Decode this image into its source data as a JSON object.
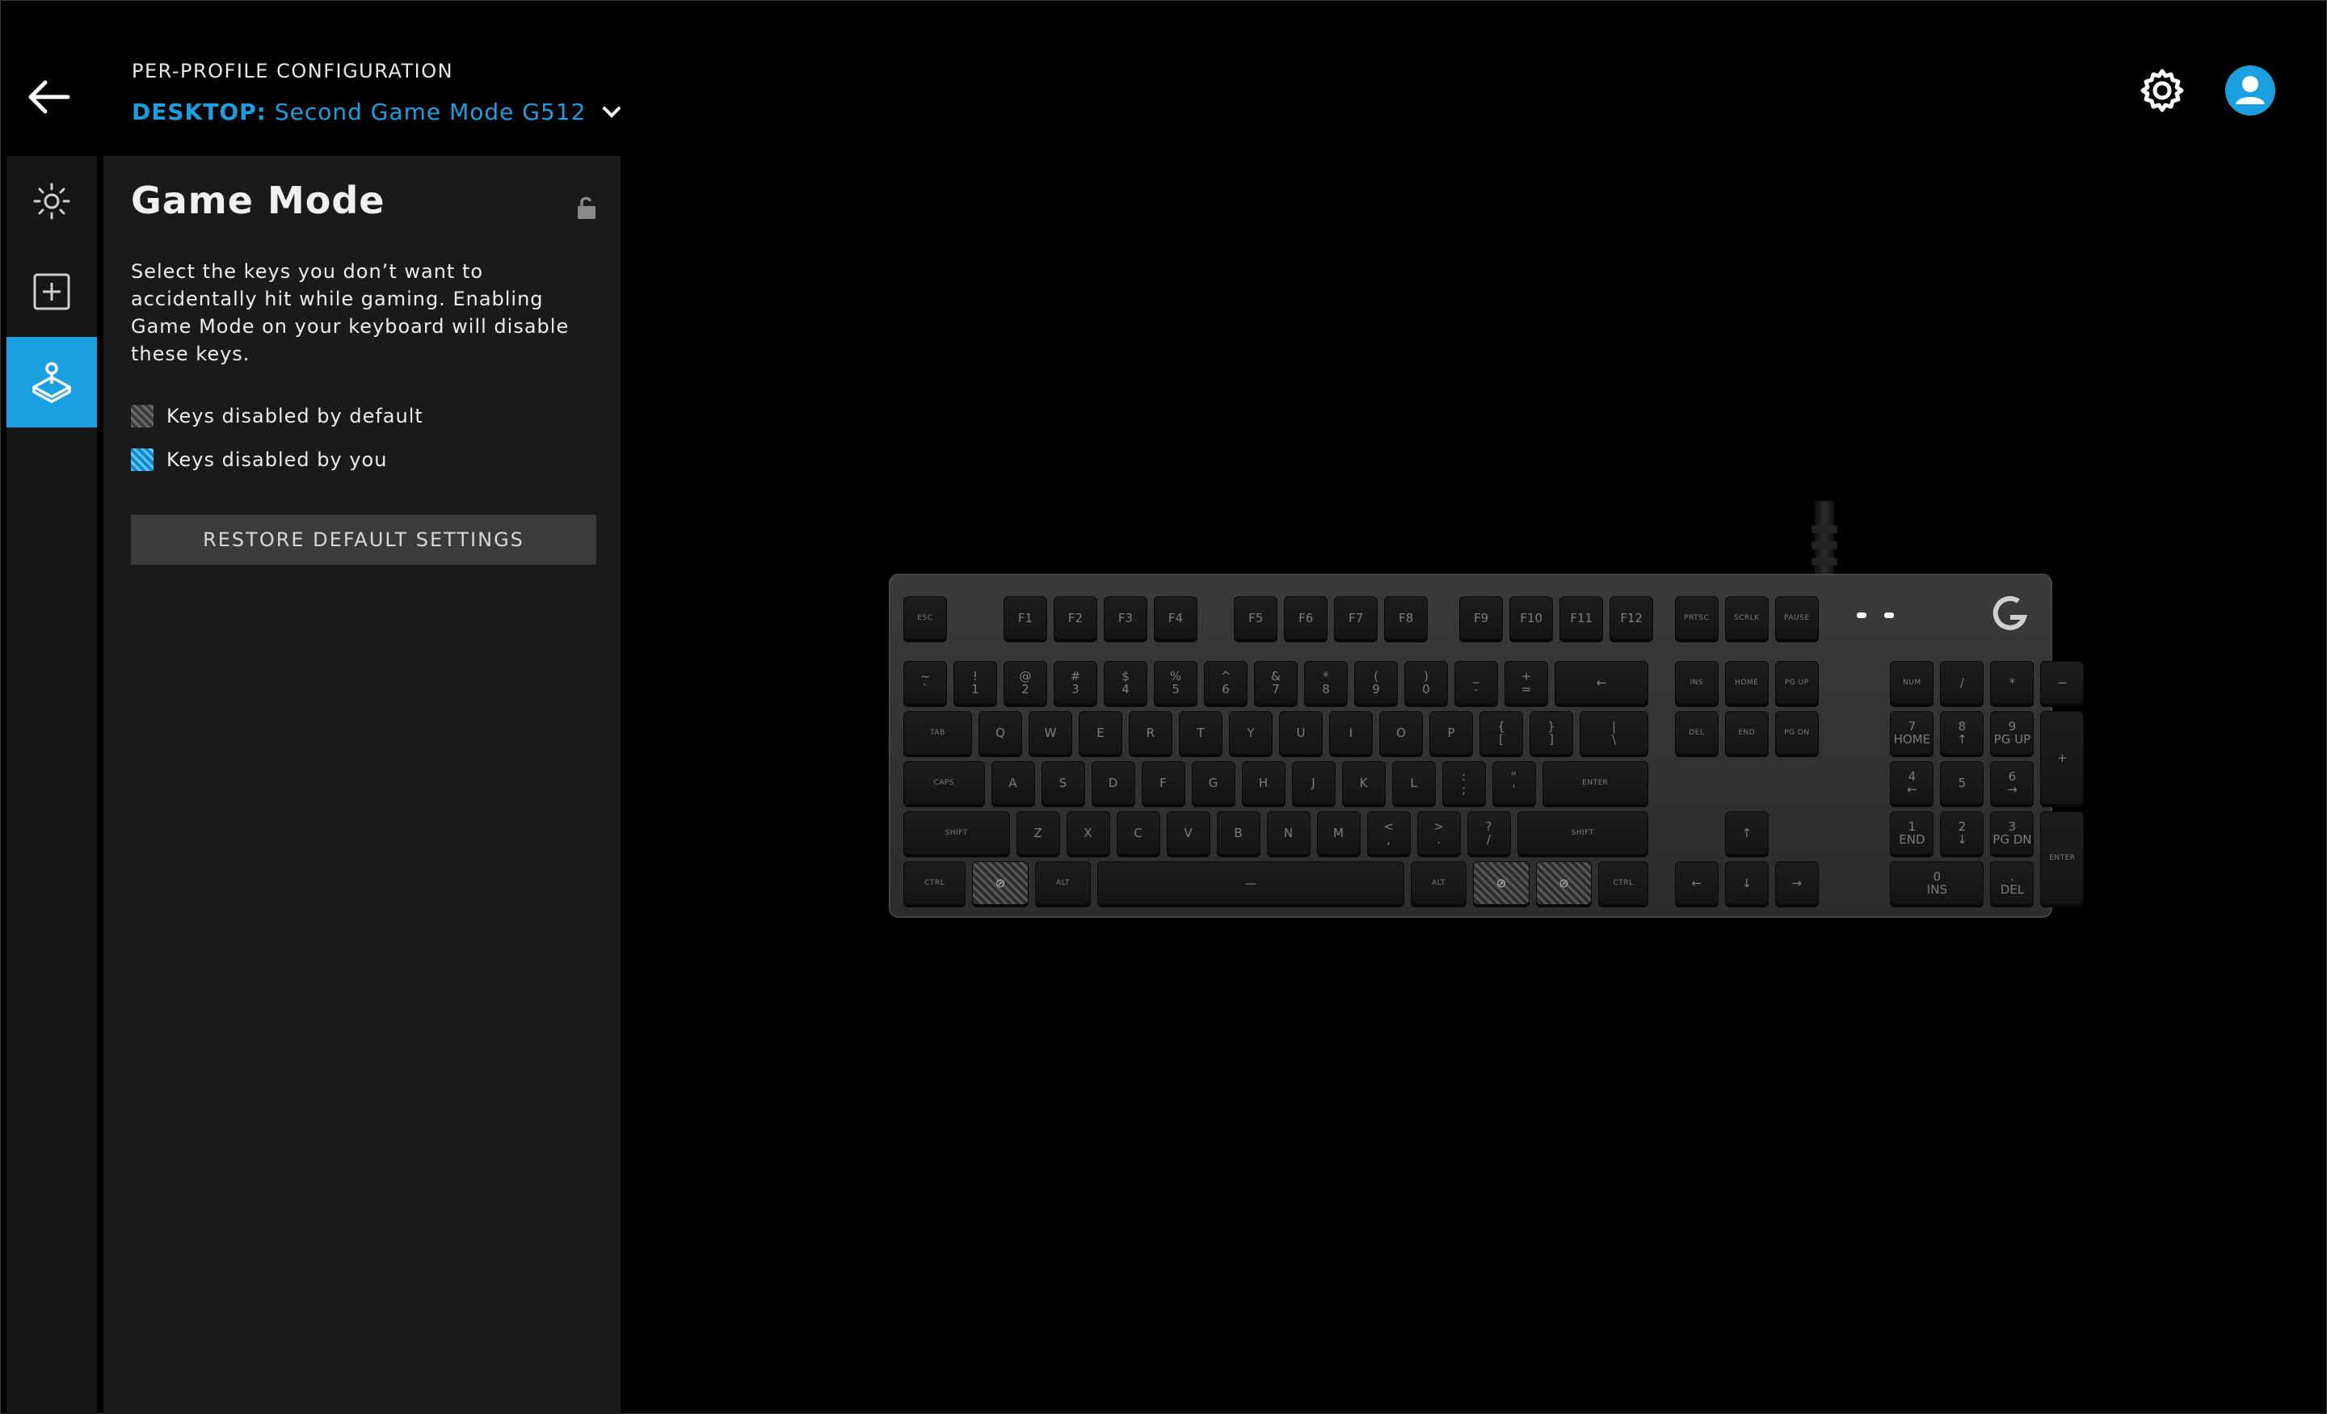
{
  "header": {
    "section_label": "PER-PROFILE CONFIGURATION",
    "profile_prefix": "DESKTOP:",
    "profile_name": "Second Game Mode G512",
    "icons": {
      "back": "arrow-left-icon",
      "dropdown": "chevron-down-icon",
      "settings": "gear-icon",
      "account": "user-avatar-icon"
    }
  },
  "rail": {
    "items": [
      {
        "id": "lighting",
        "icon": "sun-icon"
      },
      {
        "id": "assignments",
        "icon": "plus-square-icon"
      },
      {
        "id": "game-mode",
        "icon": "joystick-icon",
        "active": true
      }
    ]
  },
  "panel": {
    "title": "Game Mode",
    "lock_icon": "unlock-icon",
    "description": "Select the keys you don’t want to accidentally hit while gaming. Enabling Game Mode on your keyboard will disable these keys.",
    "legend": [
      {
        "label": "Keys disabled by default",
        "swatch": "default"
      },
      {
        "label": "Keys disabled by you",
        "swatch": "user"
      }
    ],
    "restore_label": "RESTORE DEFAULT SETTINGS"
  },
  "colors": {
    "accent": "#1aa0e0",
    "background": "#000000",
    "panel": "#1a1a1a",
    "rail": "#161616"
  },
  "keyboard": {
    "logo": "logitech-g-logo-icon",
    "disabled_by_default": [
      "left-windows",
      "right-windows",
      "menu"
    ],
    "disabled_by_you": [],
    "disabled_icon": "no-entry-icon",
    "keys": [
      {
        "id": "esc",
        "label": "ESC",
        "small": true
      },
      {
        "id": "f1",
        "label": "F1"
      },
      {
        "id": "f2",
        "label": "F2"
      },
      {
        "id": "f3",
        "label": "F3"
      },
      {
        "id": "f4",
        "label": "F4"
      },
      {
        "id": "f5",
        "label": "F5"
      },
      {
        "id": "f6",
        "label": "F6"
      },
      {
        "id": "f7",
        "label": "F7"
      },
      {
        "id": "f8",
        "label": "F8"
      },
      {
        "id": "f9",
        "label": "F9"
      },
      {
        "id": "f10",
        "label": "F10"
      },
      {
        "id": "f11",
        "label": "F11"
      },
      {
        "id": "f12",
        "label": "F12"
      },
      {
        "id": "prtsc",
        "label": "PRTSC",
        "small": true
      },
      {
        "id": "scrlk",
        "label": "SCRLK",
        "small": true
      },
      {
        "id": "pause",
        "label": "PAUSE",
        "small": true
      },
      {
        "id": "backtick",
        "label": "~\n`"
      },
      {
        "id": "1",
        "label": "!\n1"
      },
      {
        "id": "2",
        "label": "@\n2"
      },
      {
        "id": "3",
        "label": "#\n3"
      },
      {
        "id": "4",
        "label": "$\n4"
      },
      {
        "id": "5",
        "label": "%\n5"
      },
      {
        "id": "6",
        "label": "^\n6"
      },
      {
        "id": "7",
        "label": "&\n7"
      },
      {
        "id": "8",
        "label": "*\n8"
      },
      {
        "id": "9",
        "label": "(\n9"
      },
      {
        "id": "0",
        "label": ")\n0"
      },
      {
        "id": "minus",
        "label": "_\n-"
      },
      {
        "id": "equal",
        "label": "+\n="
      },
      {
        "id": "backspace",
        "label": "←"
      },
      {
        "id": "ins",
        "label": "INS",
        "small": true
      },
      {
        "id": "home",
        "label": "HOME",
        "small": true
      },
      {
        "id": "pgup",
        "label": "PG UP",
        "small": true
      },
      {
        "id": "numlk",
        "label": "NUM",
        "small": true
      },
      {
        "id": "np-div",
        "label": "/"
      },
      {
        "id": "np-mul",
        "label": "*"
      },
      {
        "id": "np-sub",
        "label": "−"
      },
      {
        "id": "tab",
        "label": "TAB",
        "small": true
      },
      {
        "id": "q",
        "label": "Q"
      },
      {
        "id": "w",
        "label": "W"
      },
      {
        "id": "e",
        "label": "E"
      },
      {
        "id": "r",
        "label": "R"
      },
      {
        "id": "t",
        "label": "T"
      },
      {
        "id": "y",
        "label": "Y"
      },
      {
        "id": "u",
        "label": "U"
      },
      {
        "id": "i",
        "label": "I"
      },
      {
        "id": "o",
        "label": "O"
      },
      {
        "id": "p",
        "label": "P"
      },
      {
        "id": "lbracket",
        "label": "{\n["
      },
      {
        "id": "rbracket",
        "label": "}\n]"
      },
      {
        "id": "backslash",
        "label": "|\n\\"
      },
      {
        "id": "del",
        "label": "DEL",
        "small": true
      },
      {
        "id": "end",
        "label": "END",
        "small": true
      },
      {
        "id": "pgdn",
        "label": "PG DN",
        "small": true
      },
      {
        "id": "np7",
        "label": "7\nHOME"
      },
      {
        "id": "np8",
        "label": "8\n↑"
      },
      {
        "id": "np9",
        "label": "9\nPG UP"
      },
      {
        "id": "np-add",
        "label": "+"
      },
      {
        "id": "caps",
        "label": "CAPS",
        "small": true
      },
      {
        "id": "a",
        "label": "A"
      },
      {
        "id": "s",
        "label": "S"
      },
      {
        "id": "d",
        "label": "D"
      },
      {
        "id": "f",
        "label": "F"
      },
      {
        "id": "g",
        "label": "G"
      },
      {
        "id": "h",
        "label": "H"
      },
      {
        "id": "j",
        "label": "J"
      },
      {
        "id": "k",
        "label": "K"
      },
      {
        "id": "l",
        "label": "L"
      },
      {
        "id": "semicolon",
        "label": ":\n;"
      },
      {
        "id": "quote",
        "label": "\"\n'"
      },
      {
        "id": "enter",
        "label": "ENTER",
        "small": true
      },
      {
        "id": "np4",
        "label": "4\n←"
      },
      {
        "id": "np5",
        "label": "5"
      },
      {
        "id": "np6",
        "label": "6\n→"
      },
      {
        "id": "lshift",
        "label": "SHIFT",
        "small": true
      },
      {
        "id": "z",
        "label": "Z"
      },
      {
        "id": "x",
        "label": "X"
      },
      {
        "id": "c",
        "label": "C"
      },
      {
        "id": "v",
        "label": "V"
      },
      {
        "id": "b",
        "label": "B"
      },
      {
        "id": "n",
        "label": "N"
      },
      {
        "id": "m",
        "label": "M"
      },
      {
        "id": "comma",
        "label": "<\n,"
      },
      {
        "id": "period",
        "label": ">\n."
      },
      {
        "id": "slash",
        "label": "?\n/"
      },
      {
        "id": "rshift",
        "label": "SHIFT",
        "small": true
      },
      {
        "id": "up",
        "label": "↑"
      },
      {
        "id": "np1",
        "label": "1\nEND"
      },
      {
        "id": "np2",
        "label": "2\n↓"
      },
      {
        "id": "np3",
        "label": "3\nPG DN"
      },
      {
        "id": "np-enter",
        "label": "ENTER",
        "small": true
      },
      {
        "id": "lctrl",
        "label": "CTRL",
        "small": true
      },
      {
        "id": "left-windows",
        "label": "⊘"
      },
      {
        "id": "lalt",
        "label": "ALT",
        "small": true
      },
      {
        "id": "space",
        "label": "—"
      },
      {
        "id": "ralt",
        "label": "ALT",
        "small": true
      },
      {
        "id": "right-windows",
        "label": "⊘"
      },
      {
        "id": "menu",
        "label": "⊘"
      },
      {
        "id": "rctrl",
        "label": "CTRL",
        "small": true
      },
      {
        "id": "left",
        "label": "←"
      },
      {
        "id": "down",
        "label": "↓"
      },
      {
        "id": "right",
        "label": "→"
      },
      {
        "id": "np0",
        "label": "0\nINS"
      },
      {
        "id": "np-dot",
        "label": ".\nDEL"
      }
    ]
  }
}
